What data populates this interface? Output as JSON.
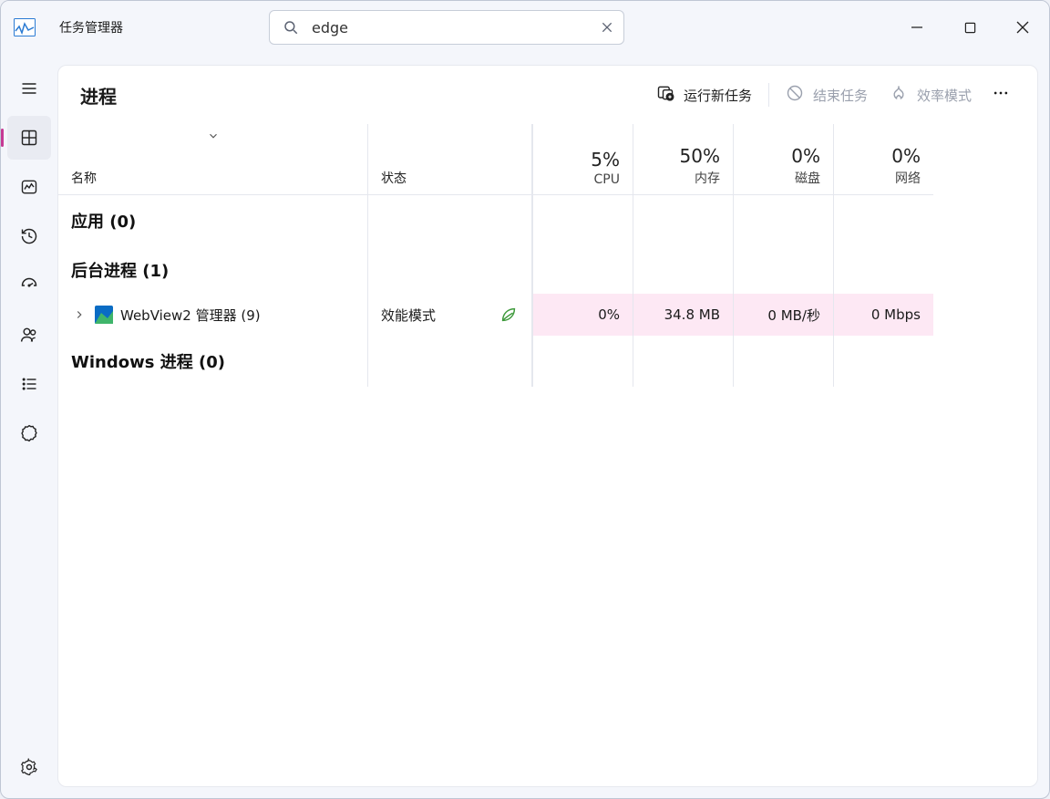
{
  "header": {
    "title": "任务管理器",
    "search_value": "edge",
    "search_placeholder": ""
  },
  "toolbar": {
    "page_title": "进程",
    "new_task_label": "运行新任务",
    "end_task_label": "结束任务",
    "efficiency_label": "效率模式"
  },
  "columns": {
    "name_label": "名称",
    "status_label": "状态",
    "cpu": {
      "value": "5%",
      "label": "CPU"
    },
    "memory": {
      "value": "50%",
      "label": "内存"
    },
    "disk": {
      "value": "0%",
      "label": "磁盘"
    },
    "network": {
      "value": "0%",
      "label": "网络"
    }
  },
  "groups": {
    "apps_title": "应用 (0)",
    "background_title": "后台进程 (1)",
    "windows_title": "Windows 进程 (0)"
  },
  "process": {
    "name": "WebView2 管理器 (9)",
    "status": "效能模式",
    "cpu": "0%",
    "memory": "34.8 MB",
    "disk": "0 MB/秒",
    "network": "0 Mbps"
  }
}
